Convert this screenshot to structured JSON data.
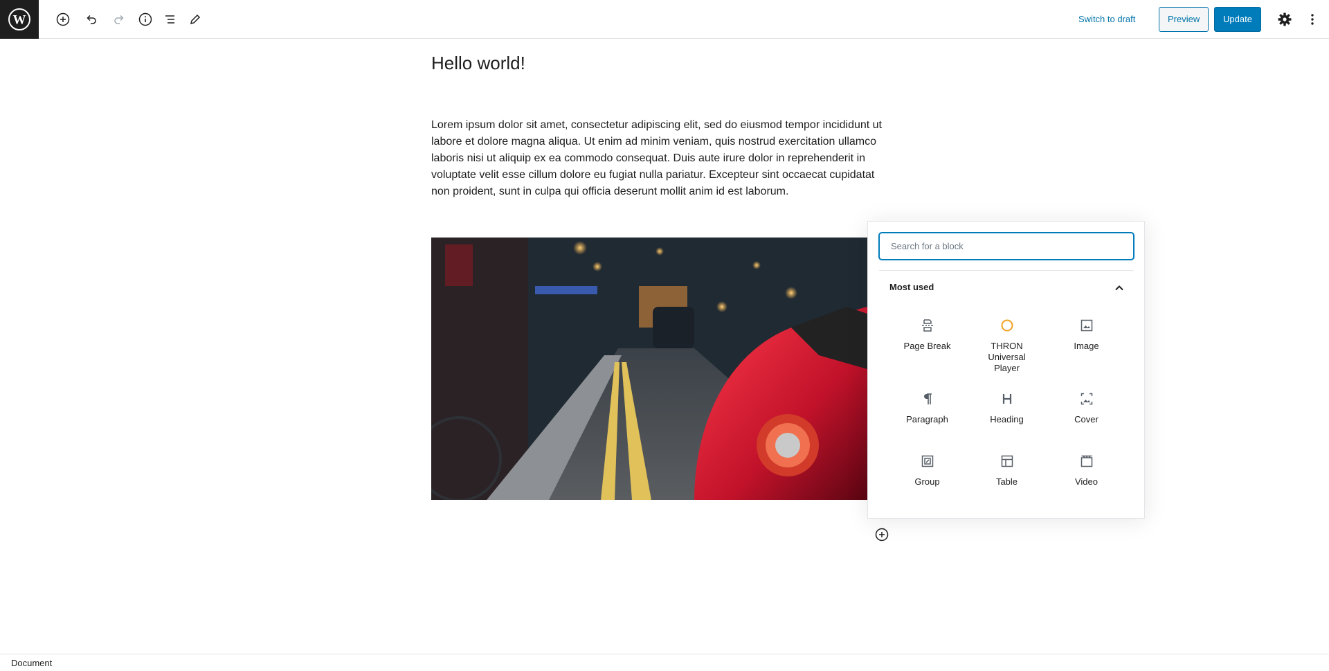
{
  "toolbar": {
    "switch_to_draft": "Switch to draft",
    "preview": "Preview",
    "update": "Update",
    "icons": [
      "wordpress-logo",
      "add-block-icon",
      "undo-icon",
      "redo-icon",
      "info-icon",
      "block-navigation-icon",
      "tools-pencil-icon",
      "settings-gear-icon",
      "more-options-icon"
    ]
  },
  "post": {
    "title": "Hello world!",
    "paragraph": "Lorem ipsum dolor sit amet, consectetur adipiscing elit, sed do eiusmod tempor incididunt ut labore et dolore magna aliqua. Ut enim ad minim veniam, quis nostrud exercitation ullamco laboris nisi ut aliquip ex ea commodo consequat. Duis aute irure dolor in reprehenderit in voluptate velit esse cillum dolore eu fugiat nulla pariatur. Excepteur sint occaecat cupidatat non proident, sunt in culpa qui officia deserunt mollit anim id est laborum."
  },
  "inserter": {
    "search_placeholder": "Search for a block",
    "panel_title": "Most used",
    "blocks": [
      {
        "label": "Page Break",
        "icon": "page-break-icon"
      },
      {
        "label": "THRON Universal Player",
        "icon": "thron-player-icon"
      },
      {
        "label": "Image",
        "icon": "image-icon"
      },
      {
        "label": "Paragraph",
        "icon": "paragraph-icon"
      },
      {
        "label": "Heading",
        "icon": "heading-icon"
      },
      {
        "label": "Cover",
        "icon": "cover-icon"
      },
      {
        "label": "Group",
        "icon": "group-icon"
      },
      {
        "label": "Table",
        "icon": "table-icon"
      },
      {
        "label": "Video",
        "icon": "video-icon"
      }
    ]
  },
  "footer": {
    "breadcrumb": "Document"
  },
  "colors": {
    "accent": "#007cba",
    "link": "#0073aa",
    "thron_orange": "#f0a020"
  }
}
